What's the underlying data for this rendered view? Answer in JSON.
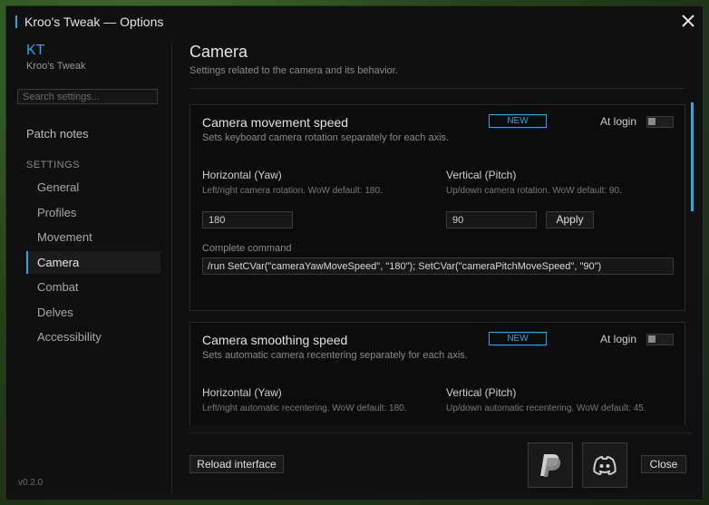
{
  "window": {
    "title": "Kroo's Tweak — Options"
  },
  "sidebar": {
    "brand_short": "KT",
    "brand_name": "Kroo's Tweak",
    "search_placeholder": "Search settings...",
    "patch_notes": "Patch notes",
    "section_label": "SETTINGS",
    "items": [
      {
        "label": "General"
      },
      {
        "label": "Profiles"
      },
      {
        "label": "Movement"
      },
      {
        "label": "Camera",
        "active": true
      },
      {
        "label": "Combat"
      },
      {
        "label": "Delves"
      },
      {
        "label": "Accessibility"
      }
    ],
    "version": "v0.2.0"
  },
  "main": {
    "title": "Camera",
    "subtitle": "Settings related to the camera and its behavior.",
    "cards": [
      {
        "title": "Camera movement speed",
        "badge": "NEW",
        "at_login_label": "At login",
        "at_login_on": false,
        "description": "Sets keyboard camera rotation separately for each axis.",
        "horizontal": {
          "label": "Horizontal (Yaw)",
          "help": "Left/right camera rotation. WoW default: 180.",
          "value": "180"
        },
        "vertical": {
          "label": "Vertical (Pitch)",
          "help": "Up/down camera rotation. WoW default: 90.",
          "value": "90"
        },
        "apply_label": "Apply",
        "command_label": "Complete command",
        "command_value": "/run SetCVar(\"cameraYawMoveSpeed\", \"180\"); SetCVar(\"cameraPitchMoveSpeed\", \"90\")"
      },
      {
        "title": "Camera smoothing speed",
        "badge": "NEW",
        "at_login_label": "At login",
        "at_login_on": false,
        "description": "Sets automatic camera recentering separately for each axis.",
        "horizontal": {
          "label": "Horizontal (Yaw)",
          "help": "Left/right automatic recentering. WoW default: 180."
        },
        "vertical": {
          "label": "Vertical (Pitch)",
          "help": "Up/down automatic recentering. WoW default: 45."
        }
      }
    ]
  },
  "footer": {
    "reload_label": "Reload interface",
    "close_label": "Close"
  },
  "icons": {
    "paypal": "paypal-icon",
    "discord": "discord-icon",
    "close": "close-icon"
  },
  "colors": {
    "accent": "#2aa8e0",
    "window_bg": "#101010"
  }
}
